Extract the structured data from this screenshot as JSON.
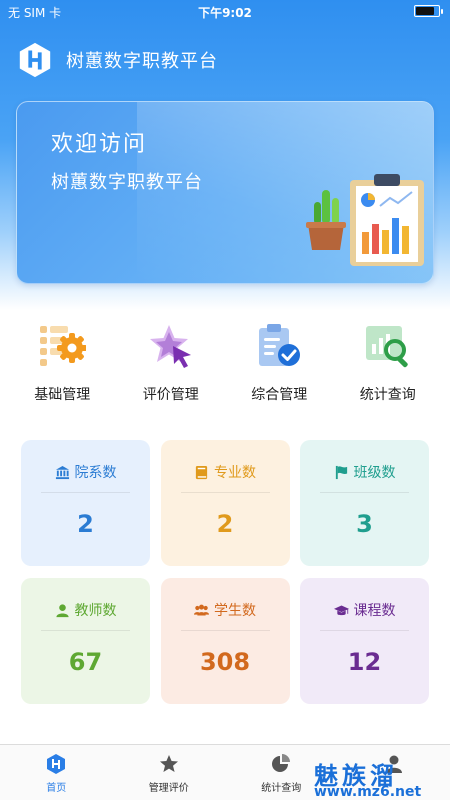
{
  "status_bar": {
    "carrier": "无 SIM 卡",
    "time": "下午9:02",
    "battery_level": 0.8
  },
  "header": {
    "logo_icon": "app-logo-icon",
    "title": "树蕙数字职教平台"
  },
  "banner": {
    "title": "欢迎访问",
    "subtitle": "树蕙数字职教平台",
    "illustration": "clipboard-chart-plant-illustration"
  },
  "quick_nav": [
    {
      "label": "基础管理",
      "icon": "gear-list-icon"
    },
    {
      "label": "评价管理",
      "icon": "star-cursor-icon"
    },
    {
      "label": "综合管理",
      "icon": "clipboard-check-icon"
    },
    {
      "label": "统计查询",
      "icon": "chart-search-icon"
    }
  ],
  "stats": [
    {
      "label": "院系数",
      "value": "2",
      "icon": "building-icon",
      "color": "#2b7cd3",
      "bg": "#e6f0fd"
    },
    {
      "label": "专业数",
      "value": "2",
      "icon": "book-icon",
      "color": "#e09a1c",
      "bg": "#fdf1e0"
    },
    {
      "label": "班级数",
      "value": "3",
      "icon": "flag-icon",
      "color": "#1f9e8e",
      "bg": "#e4f5f3"
    },
    {
      "label": "教师数",
      "value": "67",
      "icon": "user-icon",
      "color": "#5ea832",
      "bg": "#ecf6e6"
    },
    {
      "label": "学生数",
      "value": "308",
      "icon": "users-icon",
      "color": "#d2691e",
      "bg": "#fcebe3"
    },
    {
      "label": "课程数",
      "value": "12",
      "icon": "graduation-cap-icon",
      "color": "#6a2c91",
      "bg": "#f1eaf8"
    }
  ],
  "tabs": [
    {
      "label": "首页",
      "icon": "home-logo-icon",
      "active": true
    },
    {
      "label": "管理评价",
      "icon": "star-icon",
      "active": false
    },
    {
      "label": "统计查询",
      "icon": "pie-chart-icon",
      "active": false
    },
    {
      "label": "",
      "icon": "user-icon",
      "active": false
    }
  ],
  "watermark": {
    "main": "魅族溜",
    "url": "www.mz6.net"
  },
  "colors": {
    "primary": "#2f8ff0",
    "tab_active": "#2a7ee6"
  }
}
